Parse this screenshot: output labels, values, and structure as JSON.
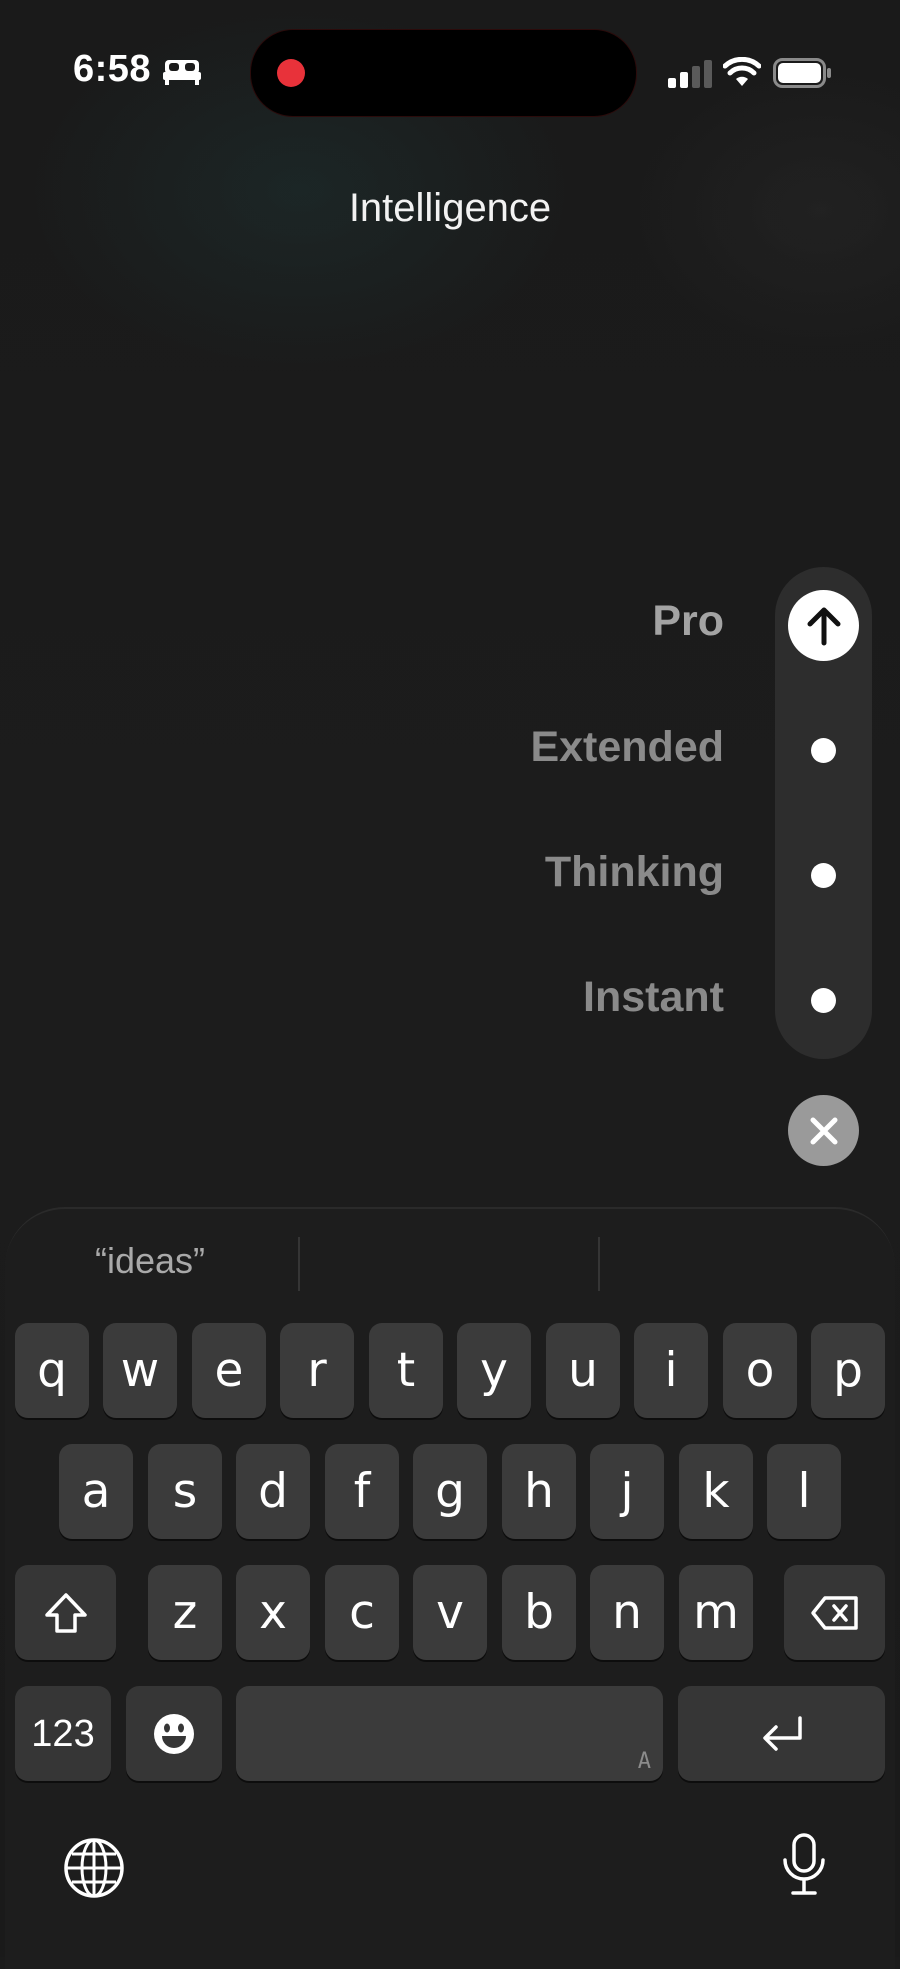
{
  "status_bar": {
    "time": "6:58",
    "icons": [
      "bed-icon",
      "signal-icon",
      "wifi-icon",
      "battery-icon"
    ],
    "recording_indicator_color": "#e8323a"
  },
  "header": {
    "title": "Intelligence"
  },
  "mode_picker": {
    "selected": "Pro",
    "options": [
      {
        "label": "Pro"
      },
      {
        "label": "Extended"
      },
      {
        "label": "Thinking"
      },
      {
        "label": "Instant"
      }
    ],
    "send_icon": "arrow-up-icon",
    "close_icon": "close-icon"
  },
  "keyboard": {
    "suggestions": [
      "“ideas”",
      "",
      ""
    ],
    "row1": [
      "q",
      "w",
      "e",
      "r",
      "t",
      "y",
      "u",
      "i",
      "o",
      "p"
    ],
    "row2": [
      "a",
      "s",
      "d",
      "f",
      "g",
      "h",
      "j",
      "k",
      "l"
    ],
    "row3": [
      "z",
      "x",
      "c",
      "v",
      "b",
      "n",
      "m"
    ],
    "numbers_key": "123",
    "space_marker": "A",
    "function_icons": [
      "shift-icon",
      "delete-icon",
      "emoji-icon",
      "return-icon",
      "globe-icon",
      "microphone-icon"
    ]
  },
  "colors": {
    "background": "#1b1b1b",
    "key": "#3b3b3b",
    "pill": "#2d2d2d"
  }
}
